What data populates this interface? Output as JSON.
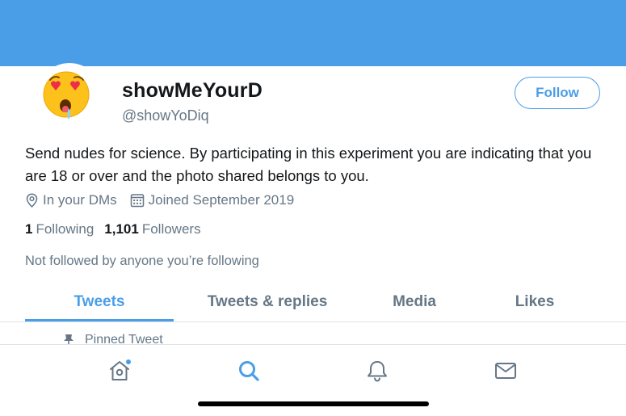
{
  "profile": {
    "display_name": "showMeYourD",
    "handle": "@showYoDiq",
    "follow_label": "Follow",
    "bio": "Send nudes for science. By participating in this experiment you are indicating that you are 18 or over and the photo shared belongs to you.",
    "location": "In your DMs",
    "joined": "Joined September 2019",
    "following_count": "1",
    "following_label": "Following",
    "followers_count": "1,101",
    "followers_label": "Followers",
    "not_followed_text": "Not followed by anyone you’re following"
  },
  "tabs": [
    {
      "label": "Tweets",
      "active": true
    },
    {
      "label": "Tweets & replies",
      "active": false
    },
    {
      "label": "Media",
      "active": false
    },
    {
      "label": "Likes",
      "active": false
    }
  ],
  "pinned": {
    "label": "Pinned Tweet"
  },
  "bottom_nav": {
    "items": [
      {
        "icon": "home-icon",
        "has_notification_dot": true
      },
      {
        "icon": "search-icon",
        "active": true
      },
      {
        "icon": "bell-icon"
      },
      {
        "icon": "mail-icon"
      }
    ]
  },
  "colors": {
    "accent": "#4a9ee8",
    "text_primary": "#14171a",
    "text_secondary": "#657786",
    "banner": "#4a9ee8"
  }
}
